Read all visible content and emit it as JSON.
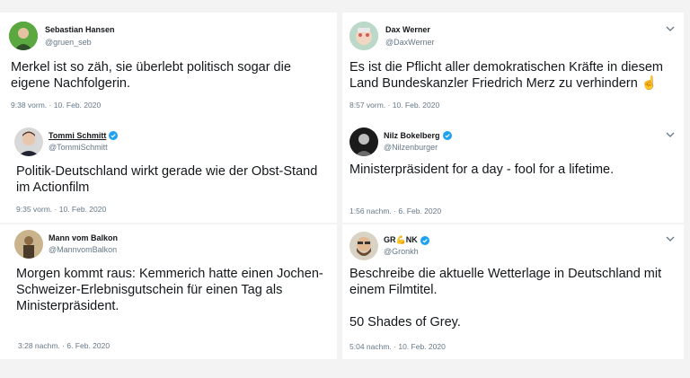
{
  "tweets": [
    {
      "name": "Sebastian Hansen",
      "handle": "@gruen_seb",
      "text": "Merkel ist so zäh, sie überlebt politisch sogar die eigene Nachfolgerin.",
      "time": "9:38 vorm.",
      "date": "10. Feb. 2020",
      "verified": false,
      "avatar": "avatar-green-portrait"
    },
    {
      "name": "Dax Werner",
      "handle": "@DaxWerner",
      "text": "Es ist die Pflicht aller demokratischen Kräfte in diesem Land Bundeskanzler Friedrich Merz zu verhindern ☝️",
      "time": "8:57 vorm.",
      "date": "10. Feb. 2020",
      "verified": false,
      "avatar": "avatar-cartoon-face"
    },
    {
      "name": "Tommi Schmitt",
      "handle": "@TommiSchmitt",
      "text": "Politik-Deutschland wirkt gerade wie der Obst-Stand im Actionfilm",
      "time": "9:35 vorm.",
      "date": "10. Feb. 2020",
      "verified": true,
      "avatar": "avatar-man-portrait"
    },
    {
      "name": "Nilz Bokelberg",
      "handle": "@Nilzenburger",
      "text": "Ministerpräsident for a day - fool for a lifetime.",
      "time": "1:56 nachm.",
      "date": "6. Feb. 2020",
      "verified": true,
      "avatar": "avatar-dark-portrait"
    },
    {
      "name": "Mann vom Balkon",
      "handle": "@MannvomBalkon",
      "text": "Morgen kommt raus: Kemmerich hatte einen Jochen-Schweizer-Erlebnisgutschein für einen Tag als Ministerpräsident.",
      "time": "3:28 nachm.",
      "date": "6. Feb. 2020",
      "verified": false,
      "avatar": "avatar-vintage-portrait"
    },
    {
      "name": "GR💪NK",
      "handle": "@Gronkh",
      "text": "Beschreibe die aktuelle Wetterlage in Deutschland mit einem Filmtitel.\n\n50 Shades of Grey.",
      "time": "5:04 nachm.",
      "date": "10. Feb. 2020",
      "verified": true,
      "avatar": "avatar-bearded-portrait"
    }
  ],
  "colors": {
    "verified": "#1da1f2",
    "meta": "#657786",
    "text": "#14171a"
  },
  "icons": [
    "verified-badge-icon",
    "chevron-down-icon"
  ]
}
